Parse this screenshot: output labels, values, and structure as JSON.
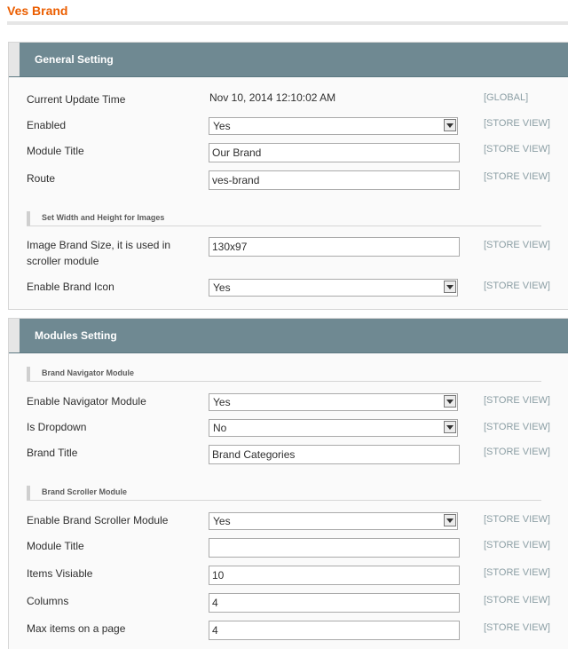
{
  "page": {
    "title": "Ves Brand"
  },
  "general": {
    "header": "General Setting",
    "current_update_label": "Current Update Time",
    "current_update_value": "Nov 10, 2014 12:10:02 AM",
    "current_update_scope": "[GLOBAL]",
    "enabled_label": "Enabled",
    "enabled_value": "Yes",
    "enabled_scope": "[STORE VIEW]",
    "module_title_label": "Module Title",
    "module_title_value": "Our Brand",
    "module_title_scope": "[STORE VIEW]",
    "route_label": "Route",
    "route_value": "ves-brand",
    "route_scope": "[STORE VIEW]",
    "images_subhead": "Set Width and Height for Images",
    "image_size_label_line1": "Image Brand Size, it is used in",
    "image_size_label_line2": "scroller module",
    "image_size_value": "130x97",
    "image_size_scope": "[STORE VIEW]",
    "brand_icon_label": "Enable Brand Icon",
    "brand_icon_value": "Yes",
    "brand_icon_scope": "[STORE VIEW]"
  },
  "modules": {
    "header": "Modules Setting",
    "navigator_subhead": "Brand Navigator Module",
    "enable_nav_label": "Enable Navigator Module",
    "enable_nav_value": "Yes",
    "enable_nav_scope": "[STORE VIEW]",
    "dropdown_label": "Is Dropdown",
    "dropdown_value": "No",
    "dropdown_scope": "[STORE VIEW]",
    "brand_title_label": "Brand Title",
    "brand_title_value": "Brand Categories",
    "brand_title_scope": "[STORE VIEW]",
    "scroller_subhead": "Brand Scroller Module",
    "enable_scroller_label": "Enable Brand Scroller Module",
    "enable_scroller_value": "Yes",
    "enable_scroller_scope": "[STORE VIEW]",
    "scroller_title_label": "Module Title",
    "scroller_title_value": "",
    "scroller_title_scope": "[STORE VIEW]",
    "items_visible_label": "Items Visiable",
    "items_visible_value": "10",
    "items_visible_scope": "[STORE VIEW]",
    "columns_label": "Columns",
    "columns_value": "4",
    "columns_scope": "[STORE VIEW]",
    "max_items_label": "Max items on a page",
    "max_items_value": "4",
    "max_items_scope": "[STORE VIEW]"
  }
}
